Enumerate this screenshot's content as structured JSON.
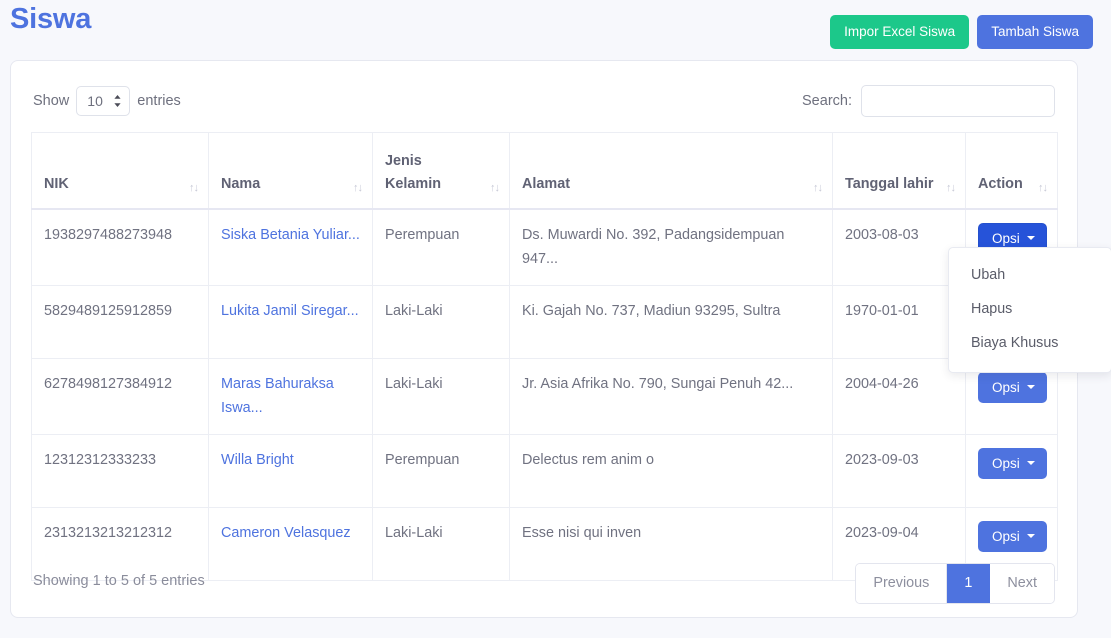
{
  "header": {
    "title": "Siswa",
    "buttons": [
      {
        "label": "Impor Excel Siswa",
        "name": "import-excel-button",
        "style": "success"
      },
      {
        "label": "Tambah Siswa",
        "name": "add-student-button",
        "style": "primary"
      }
    ]
  },
  "datatable": {
    "length_label_before": "Show",
    "length_label_after": "entries",
    "length_value": "10",
    "search_label": "Search:",
    "search_value": "",
    "search_placeholder": "",
    "columns": [
      {
        "label": "NIK",
        "sort": "↑↓"
      },
      {
        "label": "Nama",
        "sort": "↑↓"
      },
      {
        "label": "Jenis Kelamin",
        "sort": "↑↓"
      },
      {
        "label": "Alamat",
        "sort": "↑↓"
      },
      {
        "label": "Tanggal lahir",
        "sort": "↑↓"
      },
      {
        "label": "Action",
        "sort": "↑↓"
      }
    ],
    "rows": [
      {
        "nik": "1938297488273948",
        "nama": "Siska Betania Yuliar...",
        "jenis_kelamin": "Perempuan",
        "alamat": "Ds. Muwardi No. 392, Padangsidempuan 947...",
        "tanggal_lahir": "2003-08-03",
        "action_label": "Opsi"
      },
      {
        "nik": "5829489125912859",
        "nama": "Lukita Jamil Siregar...",
        "jenis_kelamin": "Laki-Laki",
        "alamat": "Ki. Gajah No. 737, Madiun 93295, Sultra",
        "tanggal_lahir": "1970-01-01",
        "action_label": "Opsi"
      },
      {
        "nik": "6278498127384912",
        "nama": "Maras Bahuraksa Iswa...",
        "jenis_kelamin": "Laki-Laki",
        "alamat": "Jr. Asia Afrika No. 790, Sungai Penuh 42...",
        "tanggal_lahir": "2004-04-26",
        "action_label": "Opsi"
      },
      {
        "nik": "12312312333233",
        "nama": "Willa Bright",
        "jenis_kelamin": "Perempuan",
        "alamat": "Delectus rem anim o",
        "tanggal_lahir": "2023-09-03",
        "action_label": "Opsi"
      },
      {
        "nik": "2313213213212312",
        "nama": "Cameron Velasquez",
        "jenis_kelamin": "Laki-Laki",
        "alamat": "Esse nisi qui inven",
        "tanggal_lahir": "2023-09-04",
        "action_label": "Opsi"
      }
    ],
    "dropdown": {
      "open_on_row": 0,
      "items": [
        "Ubah",
        "Hapus",
        "Biaya Khusus"
      ]
    },
    "info": "Showing 1 to 5 of 5 entries",
    "pagination": {
      "previous": "Previous",
      "pages": [
        "1"
      ],
      "next": "Next",
      "active": "1"
    }
  },
  "colors": {
    "primary": "#4e73df",
    "success": "#1cc88a",
    "page_background": "#f7f8fc",
    "card_background": "#ffffff",
    "text_muted": "#707281"
  }
}
